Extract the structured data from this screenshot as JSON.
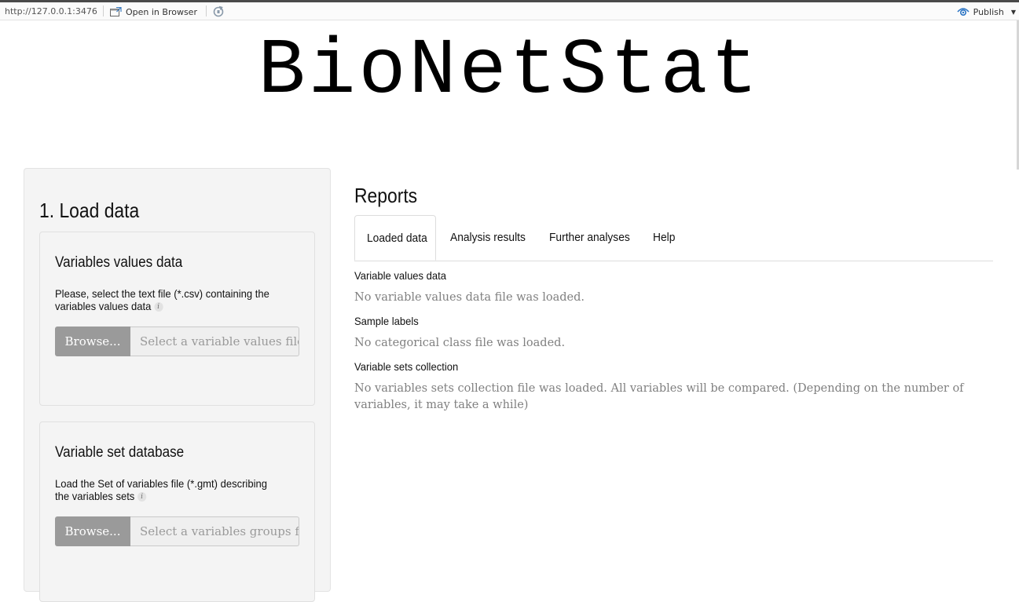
{
  "viewer": {
    "url": "http://127.0.0.1:3476",
    "open_in_browser_label": "Open in Browser",
    "publish_label": "Publish"
  },
  "app": {
    "title": "BioNetStat"
  },
  "sidebar": {
    "section_title": "1. Load data",
    "panels": [
      {
        "title": "Variables values data",
        "description": "Please, select the text file (*.csv) containing the variables values data",
        "browse_label": "Browse...",
        "placeholder": "Select a variable values file"
      },
      {
        "title": "Variable set database",
        "description": "Load the Set of variables file (*.gmt) describing the variables sets",
        "browse_label": "Browse...",
        "placeholder": "Select a variables groups file"
      }
    ]
  },
  "main": {
    "title": "Reports",
    "tabs": [
      {
        "label": "Loaded data",
        "active": true
      },
      {
        "label": "Analysis results",
        "active": false
      },
      {
        "label": "Further analyses",
        "active": false
      },
      {
        "label": "Help",
        "active": false
      }
    ],
    "sections": [
      {
        "label": "Variable values data",
        "value": "No variable values data file was loaded."
      },
      {
        "label": "Sample labels",
        "value": "No categorical class file was loaded."
      },
      {
        "label": "Variable sets collection",
        "value": "No variables sets collection file was loaded. All variables will be compared. (Depending on the number of variables, it may take a while)"
      }
    ]
  },
  "colors": {
    "browse_button": "#9a9a9a",
    "sidebar_bg": "#f4f4f4",
    "muted_text": "#808080"
  }
}
